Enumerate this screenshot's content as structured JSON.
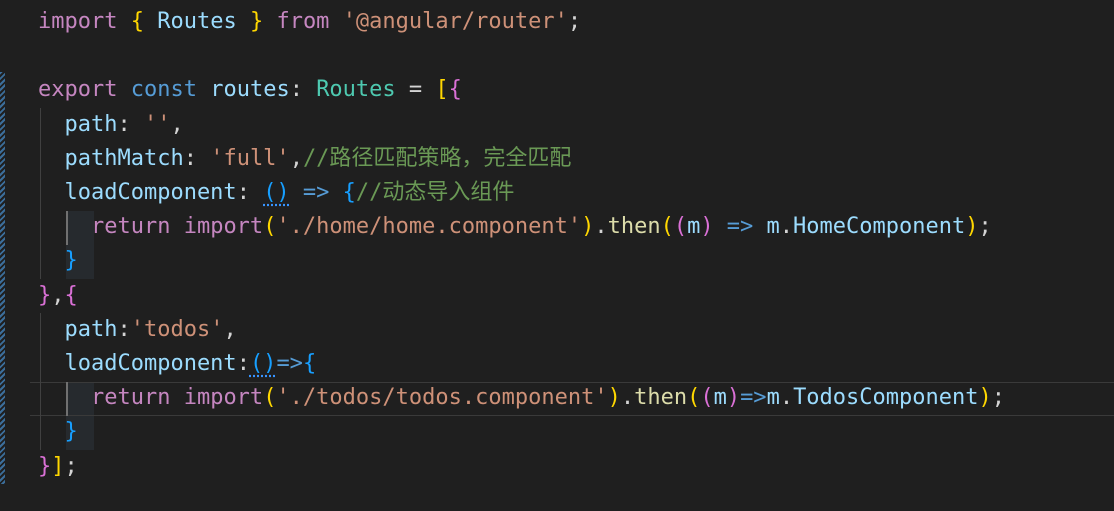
{
  "editor": {
    "colors": {
      "background": "#1f1f1f",
      "keyword": "#569cd6",
      "control": "#c586c0",
      "string": "#ce9178",
      "variable": "#9cdcfe",
      "type": "#4ec9b0",
      "function": "#dcdcaa",
      "comment": "#6a9955",
      "bracket_1": "#ffd700",
      "bracket_2": "#da70d6",
      "bracket_3": "#179fff"
    },
    "lines": [
      {
        "tokens": [
          {
            "t": "import",
            "c": "ctl"
          },
          {
            "t": " ",
            "c": "p"
          },
          {
            "t": "{",
            "c": "b1"
          },
          {
            "t": " Routes ",
            "c": "id"
          },
          {
            "t": "}",
            "c": "b1"
          },
          {
            "t": " from ",
            "c": "ctl"
          },
          {
            "t": "'@angular/router'",
            "c": "str"
          },
          {
            "t": ";",
            "c": "p"
          }
        ]
      },
      {
        "tokens": []
      },
      {
        "tokens": [
          {
            "t": "export",
            "c": "ctl"
          },
          {
            "t": " ",
            "c": "p"
          },
          {
            "t": "const",
            "c": "kw"
          },
          {
            "t": " routes",
            "c": "id"
          },
          {
            "t": ": ",
            "c": "p"
          },
          {
            "t": "Routes",
            "c": "ty"
          },
          {
            "t": " = ",
            "c": "p"
          },
          {
            "t": "[",
            "c": "b1"
          },
          {
            "t": "{",
            "c": "b2"
          }
        ]
      },
      {
        "tokens": [
          {
            "t": "  path",
            "c": "id"
          },
          {
            "t": ": ",
            "c": "p"
          },
          {
            "t": "''",
            "c": "str"
          },
          {
            "t": ",",
            "c": "p"
          }
        ]
      },
      {
        "tokens": [
          {
            "t": "  pathMatch",
            "c": "id"
          },
          {
            "t": ": ",
            "c": "p"
          },
          {
            "t": "'full'",
            "c": "str"
          },
          {
            "t": ",",
            "c": "p"
          },
          {
            "t": "//路径匹配策略，完全匹配",
            "c": "cm"
          }
        ]
      },
      {
        "tokens": [
          {
            "t": "  loadComponent",
            "c": "id"
          },
          {
            "t": ": ",
            "c": "p"
          },
          {
            "t": "()",
            "c": "b3",
            "squig": true
          },
          {
            "t": " => ",
            "c": "kw"
          },
          {
            "t": "{",
            "c": "b3"
          },
          {
            "t": "//动态导入组件",
            "c": "cm"
          }
        ]
      },
      {
        "tokens": [
          {
            "t": "    return",
            "c": "ctl"
          },
          {
            "t": " ",
            "c": "p"
          },
          {
            "t": "import",
            "c": "ctl"
          },
          {
            "t": "(",
            "c": "b1"
          },
          {
            "t": "'./home/home.component'",
            "c": "str"
          },
          {
            "t": ")",
            "c": "b1"
          },
          {
            "t": ".",
            "c": "p"
          },
          {
            "t": "then",
            "c": "fn"
          },
          {
            "t": "(",
            "c": "b1"
          },
          {
            "t": "(",
            "c": "b2"
          },
          {
            "t": "m",
            "c": "id"
          },
          {
            "t": ")",
            "c": "b2"
          },
          {
            "t": " => ",
            "c": "kw"
          },
          {
            "t": "m",
            "c": "id"
          },
          {
            "t": ".",
            "c": "p"
          },
          {
            "t": "HomeComponent",
            "c": "id"
          },
          {
            "t": ")",
            "c": "b1"
          },
          {
            "t": ";",
            "c": "p"
          }
        ]
      },
      {
        "tokens": [
          {
            "t": "  }",
            "c": "b3"
          }
        ]
      },
      {
        "tokens": [
          {
            "t": "}",
            "c": "b2"
          },
          {
            "t": ",",
            "c": "p"
          },
          {
            "t": "{",
            "c": "b2"
          }
        ]
      },
      {
        "tokens": [
          {
            "t": "  path",
            "c": "id"
          },
          {
            "t": ":",
            "c": "p"
          },
          {
            "t": "'todos'",
            "c": "str"
          },
          {
            "t": ",",
            "c": "p"
          }
        ]
      },
      {
        "tokens": [
          {
            "t": "  loadComponent",
            "c": "id"
          },
          {
            "t": ":",
            "c": "p"
          },
          {
            "t": "()",
            "c": "b3",
            "squig": true
          },
          {
            "t": "=>",
            "c": "kw"
          },
          {
            "t": "{",
            "c": "b3"
          }
        ]
      },
      {
        "tokens": [
          {
            "t": "    return",
            "c": "ctl"
          },
          {
            "t": " ",
            "c": "p"
          },
          {
            "t": "import",
            "c": "ctl"
          },
          {
            "t": "(",
            "c": "b1"
          },
          {
            "t": "'./todos/todos.component'",
            "c": "str"
          },
          {
            "t": ")",
            "c": "b1"
          },
          {
            "t": ".",
            "c": "p"
          },
          {
            "t": "then",
            "c": "fn"
          },
          {
            "t": "(",
            "c": "b1"
          },
          {
            "t": "(",
            "c": "b2"
          },
          {
            "t": "m",
            "c": "id"
          },
          {
            "t": ")",
            "c": "b2"
          },
          {
            "t": "=>",
            "c": "kw"
          },
          {
            "t": "m",
            "c": "id"
          },
          {
            "t": ".",
            "c": "p"
          },
          {
            "t": "TodosComponent",
            "c": "id"
          },
          {
            "t": ")",
            "c": "b1"
          },
          {
            "t": ";",
            "c": "p"
          }
        ]
      },
      {
        "tokens": [
          {
            "t": "  }",
            "c": "b3"
          }
        ]
      },
      {
        "tokens": [
          {
            "t": "}",
            "c": "b2"
          },
          {
            "t": "]",
            "c": "b1"
          },
          {
            "t": ";",
            "c": "p"
          }
        ]
      }
    ]
  }
}
